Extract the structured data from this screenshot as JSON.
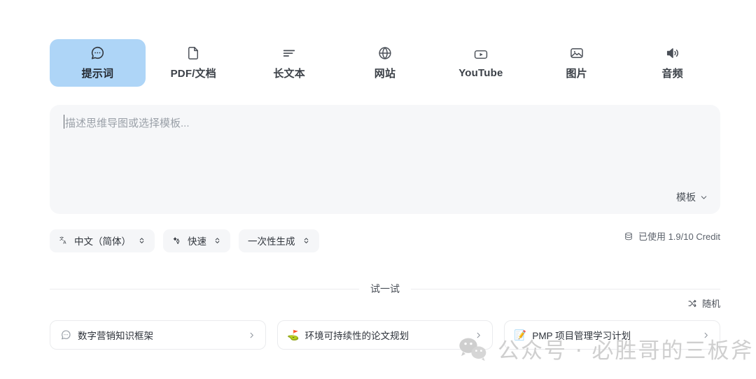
{
  "tabs": [
    {
      "label": "提示词",
      "icon": "chat-bubble-icon",
      "active": true
    },
    {
      "label": "PDF/文档",
      "icon": "document-icon",
      "active": false
    },
    {
      "label": "长文本",
      "icon": "text-lines-icon",
      "active": false
    },
    {
      "label": "网站",
      "icon": "globe-icon",
      "active": false
    },
    {
      "label": "YouTube",
      "icon": "video-play-icon",
      "active": false
    },
    {
      "label": "图片",
      "icon": "image-icon",
      "active": false
    },
    {
      "label": "音频",
      "icon": "speaker-icon",
      "active": false
    }
  ],
  "prompt": {
    "value": "",
    "placeholder": "描述思维导图或选择模板...",
    "template_label": "模板",
    "template_icon": "chevron-down-icon"
  },
  "options": [
    {
      "label": "中文（简体）",
      "icon": "translate-icon",
      "arrows": "up-down-arrows-icon"
    },
    {
      "label": "快速",
      "icon": "sparkle-icon",
      "arrows": "up-down-arrows-icon"
    },
    {
      "label": "一次性生成",
      "icon": "",
      "arrows": "up-down-arrows-icon"
    }
  ],
  "credit": {
    "icon": "database-icon",
    "text": "已使用 1.9/10 Credit"
  },
  "try_section": {
    "divider_label": "试一试",
    "shuffle_label": "随机",
    "shuffle_icon": "shuffle-icon"
  },
  "suggestions": [
    {
      "emoji": "",
      "icon": "chat-bubble-icon",
      "label": "数字营销知识框架",
      "chevron": "chevron-right-icon"
    },
    {
      "emoji": "⛳",
      "icon": "",
      "label": "环境可持续性的论文规划",
      "chevron": "chevron-right-icon"
    },
    {
      "emoji": "📝",
      "icon": "",
      "label": "PMP 项目管理学习计划",
      "chevron": "chevron-right-icon"
    }
  ],
  "watermark": {
    "logo": "wechat-logo",
    "text": "公众号 · 必胜哥的三板斧"
  },
  "colors": {
    "active_tab_bg": "#aed5f7",
    "prompt_bg": "#f6f7f9",
    "chip_bg": "#f5f6f8",
    "card_border": "#eaebed",
    "divider": "#ececee",
    "text_primary": "#2d323a",
    "text_muted": "#9aa0a8",
    "watermark": "#cfcfcf"
  }
}
